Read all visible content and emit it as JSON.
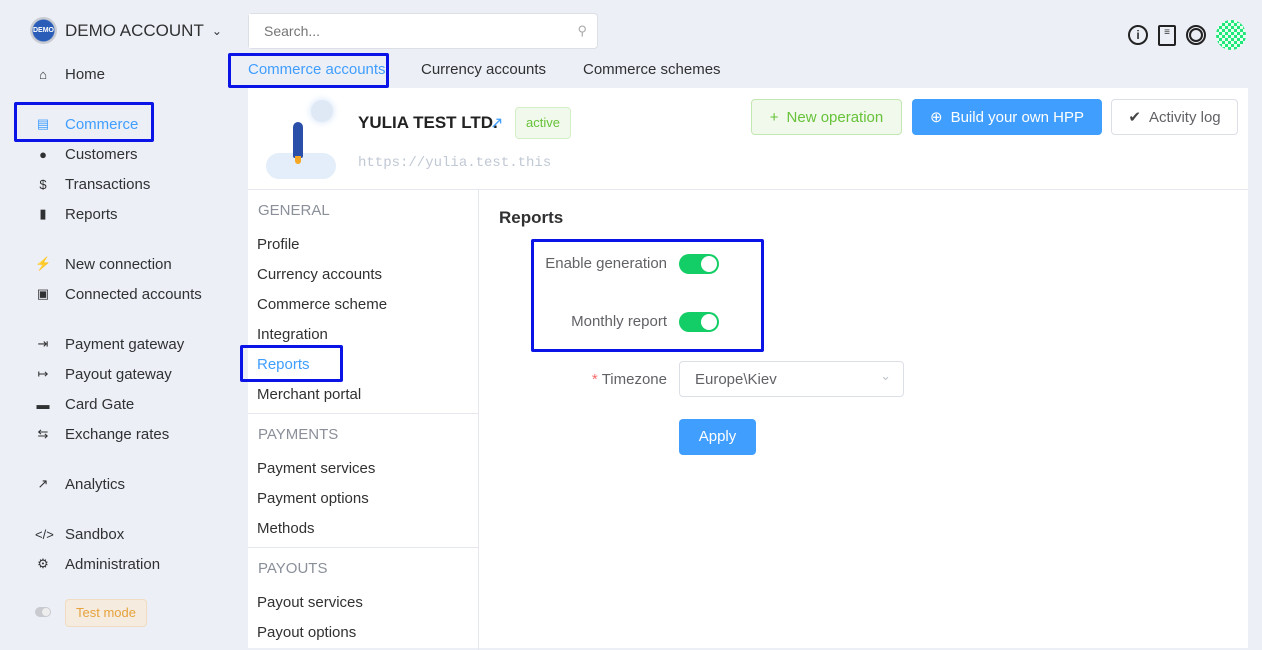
{
  "account": {
    "name": "DEMO ACCOUNT",
    "logo_text": "DEMO"
  },
  "search": {
    "placeholder": "Search..."
  },
  "sidebar": {
    "items": [
      {
        "label": "Home",
        "icon": "home-icon"
      },
      {
        "label": "Commerce",
        "icon": "store-icon",
        "active": true
      },
      {
        "label": "Customers",
        "icon": "users-icon"
      },
      {
        "label": "Transactions",
        "icon": "dollar-icon"
      },
      {
        "label": "Reports",
        "icon": "file-icon"
      },
      {
        "label": "New connection",
        "icon": "plug-icon"
      },
      {
        "label": "Connected accounts",
        "icon": "lock-icon"
      },
      {
        "label": "Payment gateway",
        "icon": "sign-in-icon"
      },
      {
        "label": "Payout gateway",
        "icon": "sign-out-icon"
      },
      {
        "label": "Card Gate",
        "icon": "card-icon"
      },
      {
        "label": "Exchange rates",
        "icon": "exchange-icon"
      },
      {
        "label": "Analytics",
        "icon": "chart-icon"
      },
      {
        "label": "Sandbox",
        "icon": "code-icon"
      },
      {
        "label": "Administration",
        "icon": "gear-icon"
      }
    ],
    "test_mode": "Test mode"
  },
  "tabs": [
    {
      "label": "Commerce accounts",
      "active": true
    },
    {
      "label": "Currency accounts"
    },
    {
      "label": "Commerce schemes"
    }
  ],
  "merchant": {
    "name": "YULIA TEST LTD.",
    "status": "active",
    "url": "https://yulia.test.this"
  },
  "actions": {
    "new_operation": "New operation",
    "build_hpp": "Build your own HPP",
    "activity_log": "Activity log"
  },
  "submenu": {
    "general": {
      "title": "GENERAL",
      "items": [
        "Profile",
        "Currency accounts",
        "Commerce scheme",
        "Integration",
        "Reports",
        "Merchant portal"
      ]
    },
    "payments": {
      "title": "PAYMENTS",
      "items": [
        "Payment services",
        "Payment options",
        "Methods"
      ]
    },
    "payouts": {
      "title": "PAYOUTS",
      "items": [
        "Payout services",
        "Payout options"
      ]
    }
  },
  "form": {
    "title": "Reports",
    "enable_generation": "Enable generation",
    "enable_generation_on": true,
    "monthly_report": "Monthly report",
    "monthly_report_on": true,
    "timezone_label": "Timezone",
    "required_mark": "*",
    "timezone_value": "Europe\\Kiev",
    "apply": "Apply"
  },
  "colors": {
    "accent": "#409eff",
    "toggle_on": "#13ce66",
    "success": "#67c23a"
  }
}
